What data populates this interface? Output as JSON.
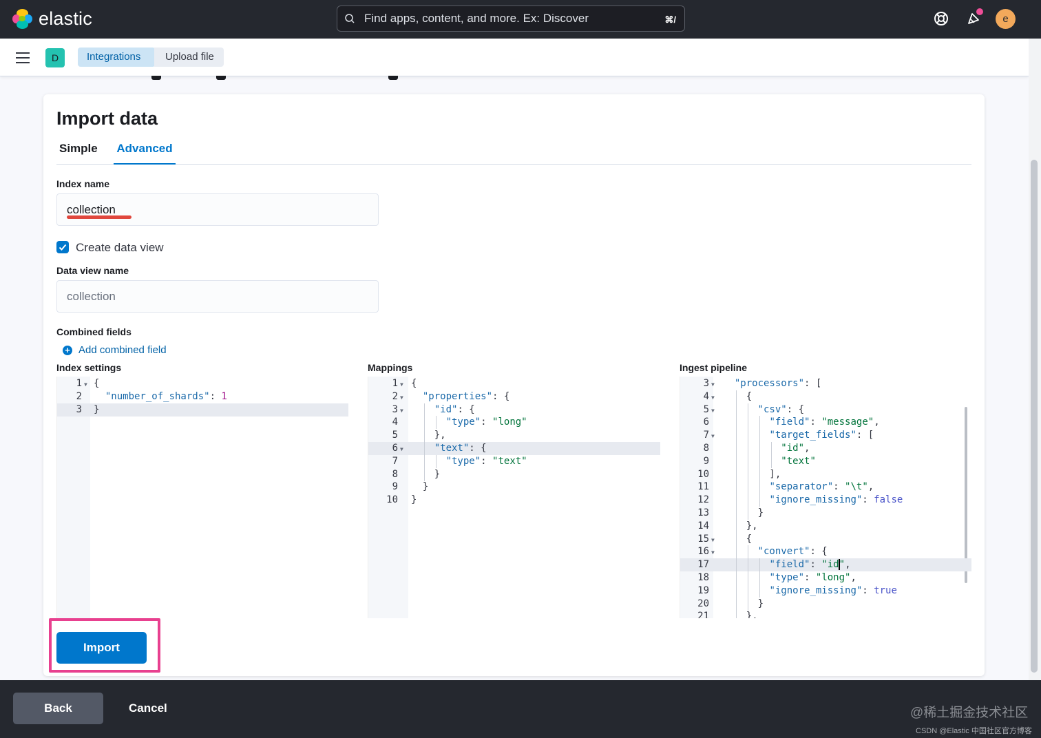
{
  "header": {
    "logo_text": "elastic",
    "search_placeholder": "Find apps, content, and more. Ex: Discover",
    "search_shortcut": "⌘/",
    "avatar_letter": "e"
  },
  "subheader": {
    "space_letter": "D",
    "breadcrumbs": [
      "Integrations",
      "Upload file"
    ]
  },
  "panel": {
    "title": "Import data",
    "tabs": [
      {
        "label": "Simple",
        "selected": false
      },
      {
        "label": "Advanced",
        "selected": true
      }
    ],
    "index_name_label": "Index name",
    "index_name_value": "collection",
    "create_data_view_label": "Create data view",
    "create_data_view_checked": true,
    "data_view_name_label": "Data view name",
    "data_view_name_placeholder": "collection",
    "combined_fields_label": "Combined fields",
    "add_combined_field_label": "Add combined field"
  },
  "editors": {
    "index_settings": {
      "label": "Index settings",
      "lines": [
        {
          "n": "1",
          "fold": true,
          "text": "{"
        },
        {
          "n": "2",
          "fold": false,
          "text": "  \"number_of_shards\": 1"
        },
        {
          "n": "3",
          "fold": false,
          "text": "}"
        }
      ]
    },
    "mappings": {
      "label": "Mappings",
      "lines": [
        {
          "n": "1",
          "fold": true,
          "text": "{"
        },
        {
          "n": "2",
          "fold": true,
          "text": "  \"properties\": {"
        },
        {
          "n": "3",
          "fold": true,
          "text": "    \"id\": {"
        },
        {
          "n": "4",
          "fold": false,
          "text": "      \"type\": \"long\""
        },
        {
          "n": "5",
          "fold": false,
          "text": "    },"
        },
        {
          "n": "6",
          "fold": true,
          "text": "    \"text\": {"
        },
        {
          "n": "7",
          "fold": false,
          "text": "      \"type\": \"text\""
        },
        {
          "n": "8",
          "fold": false,
          "text": "    }"
        },
        {
          "n": "9",
          "fold": false,
          "text": "  }"
        },
        {
          "n": "10",
          "fold": false,
          "text": "}"
        }
      ]
    },
    "ingest_pipeline": {
      "label": "Ingest pipeline",
      "lines": [
        {
          "n": "3",
          "fold": true,
          "text": "  \"processors\": ["
        },
        {
          "n": "4",
          "fold": true,
          "text": "    {"
        },
        {
          "n": "5",
          "fold": true,
          "text": "      \"csv\": {"
        },
        {
          "n": "6",
          "fold": false,
          "text": "        \"field\": \"message\","
        },
        {
          "n": "7",
          "fold": true,
          "text": "        \"target_fields\": ["
        },
        {
          "n": "8",
          "fold": false,
          "text": "          \"id\","
        },
        {
          "n": "9",
          "fold": false,
          "text": "          \"text\""
        },
        {
          "n": "10",
          "fold": false,
          "text": "        ],"
        },
        {
          "n": "11",
          "fold": false,
          "text": "        \"separator\": \"\\t\","
        },
        {
          "n": "12",
          "fold": false,
          "text": "        \"ignore_missing\": false"
        },
        {
          "n": "13",
          "fold": false,
          "text": "      }"
        },
        {
          "n": "14",
          "fold": false,
          "text": "    },"
        },
        {
          "n": "15",
          "fold": true,
          "text": "    {"
        },
        {
          "n": "16",
          "fold": true,
          "text": "      \"convert\": {"
        },
        {
          "n": "17",
          "fold": false,
          "text": "        \"field\": \"id\","
        },
        {
          "n": "18",
          "fold": false,
          "text": "        \"type\": \"long\","
        },
        {
          "n": "19",
          "fold": false,
          "text": "        \"ignore_missing\": true"
        },
        {
          "n": "20",
          "fold": false,
          "text": "      }"
        },
        {
          "n": "21",
          "fold": false,
          "text": "    },"
        }
      ]
    }
  },
  "import_button_label": "Import",
  "footer": {
    "back_label": "Back",
    "cancel_label": "Cancel",
    "watermark_1": "@稀土掘金技术社区",
    "watermark_2": "CSDN @Elastic 中国社区官方博客"
  },
  "colors": {
    "primary": "#0077cc",
    "header_bg": "#25282f",
    "highlight_box": "#e8408f",
    "underline_annotation": "#e0473d",
    "json_key": "#1a69a9",
    "json_string": "#00733a",
    "json_number": "#a31a8e",
    "json_boolean": "#4953c9"
  }
}
